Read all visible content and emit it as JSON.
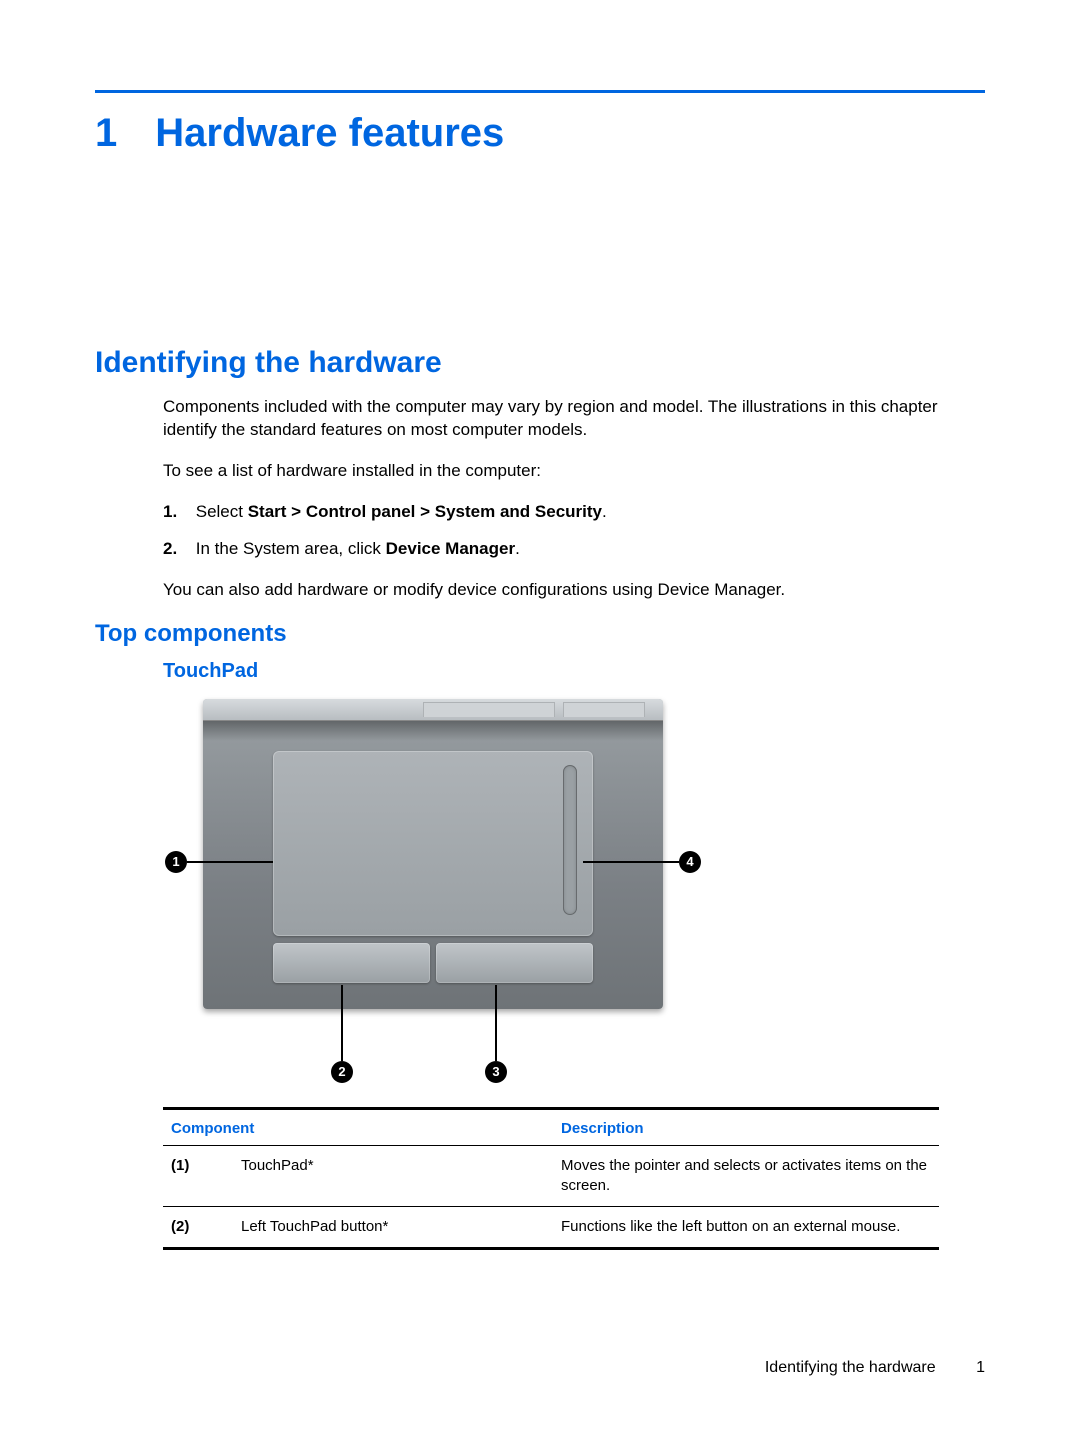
{
  "chapter": {
    "number": "1",
    "title": "Hardware features"
  },
  "section": {
    "title": "Identifying the hardware"
  },
  "intro": {
    "p1": "Components included with the computer may vary by region and model. The illustrations in this chapter identify the standard features on most computer models.",
    "p2": "To see a list of hardware installed in the computer:"
  },
  "steps": [
    {
      "num": "1.",
      "pre": "Select ",
      "bold": "Start > Control panel > System and Security",
      "post": "."
    },
    {
      "num": "2.",
      "pre": "In the System area, click ",
      "bold": "Device Manager",
      "post": "."
    }
  ],
  "intro_after": "You can also add hardware or modify device configurations using Device Manager.",
  "subsection": {
    "title": "Top components"
  },
  "subsub": {
    "title": "TouchPad"
  },
  "callouts": {
    "c1": "1",
    "c2": "2",
    "c3": "3",
    "c4": "4"
  },
  "table": {
    "headers": {
      "component": "Component",
      "description": "Description"
    },
    "rows": [
      {
        "idx": "(1)",
        "name": "TouchPad*",
        "desc": "Moves the pointer and selects or activates items on the screen."
      },
      {
        "idx": "(2)",
        "name": "Left TouchPad button*",
        "desc": "Functions like the left button on an external mouse."
      }
    ]
  },
  "footer": {
    "text": "Identifying the hardware",
    "page": "1"
  }
}
